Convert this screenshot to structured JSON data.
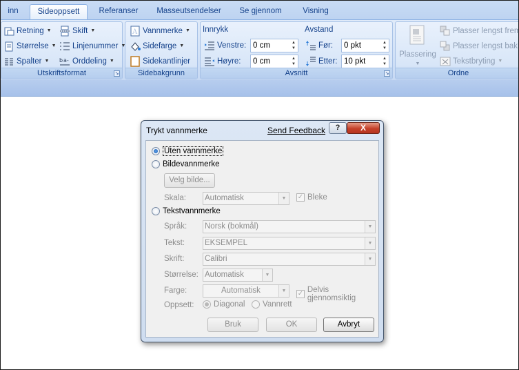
{
  "tabs": [
    {
      "label": "inn"
    },
    {
      "label": "Sideoppsett",
      "active": true
    },
    {
      "label": "Referanser"
    },
    {
      "label": "Masseutsendelser"
    },
    {
      "label": "Se gjennom"
    },
    {
      "label": "Visning"
    }
  ],
  "ribbon": {
    "utskriftsformat": {
      "label": "Utskriftsformat",
      "retning": "Retning",
      "storrelse": "Størrelse",
      "spalter": "Spalter",
      "skift": "Skift",
      "linjenummer": "Linjenummer",
      "orddeling": "Orddeling"
    },
    "sidebakgrunn": {
      "label": "Sidebakgrunn",
      "vannmerke": "Vannmerke",
      "sidefarge": "Sidefarge",
      "sidekantlinjer": "Sidekantlinjer"
    },
    "avsnitt": {
      "label": "Avsnitt",
      "innrykk_title": "Innrykk",
      "venstre_label": "Venstre:",
      "venstre_value": "0 cm",
      "hoyre_label": "Høyre:",
      "hoyre_value": "0 cm",
      "avstand_title": "Avstand",
      "for_label": "Før:",
      "for_value": "0 pkt",
      "etter_label": "Etter:",
      "etter_value": "10 pkt"
    },
    "ordne": {
      "label": "Ordne",
      "plassering": "Plassering",
      "plasser_fremst": "Plasser lengst frem",
      "plasser_bak": "Plasser lengst bak",
      "tekstbryting": "Tekstbryting"
    }
  },
  "dialog": {
    "title": "Trykt vannmerke",
    "feedback": "Send Feedback",
    "help": "?",
    "close": "X",
    "uten_vannmerke": "Uten vannmerke",
    "bildevannmerke": "Bildevannmerke",
    "velg_bilde": "Velg bilde...",
    "skala_label": "Skala:",
    "skala_value": "Automatisk",
    "bleke": "Bleke",
    "tekstvannmerke": "Tekstvannmerke",
    "sprak_label": "Språk:",
    "sprak_value": "Norsk (bokmål)",
    "tekst_label": "Tekst:",
    "tekst_value": "EKSEMPEL",
    "skrift_label": "Skrift:",
    "skrift_value": "Calibri",
    "storrelse_label": "Størrelse:",
    "storrelse_value": "Automatisk",
    "farge_label": "Farge:",
    "farge_value": "Automatisk",
    "delvis": "Delvis gjennomsiktig",
    "oppsett_label": "Oppsett:",
    "diagonal": "Diagonal",
    "vannrett": "Vannrett",
    "bruk": "Bruk",
    "ok": "OK",
    "avbryt": "Avbryt"
  },
  "colors": {
    "ribbon_text": "#15428b",
    "close_button": "#c5412a",
    "disabled_text": "#8d8d8d"
  }
}
